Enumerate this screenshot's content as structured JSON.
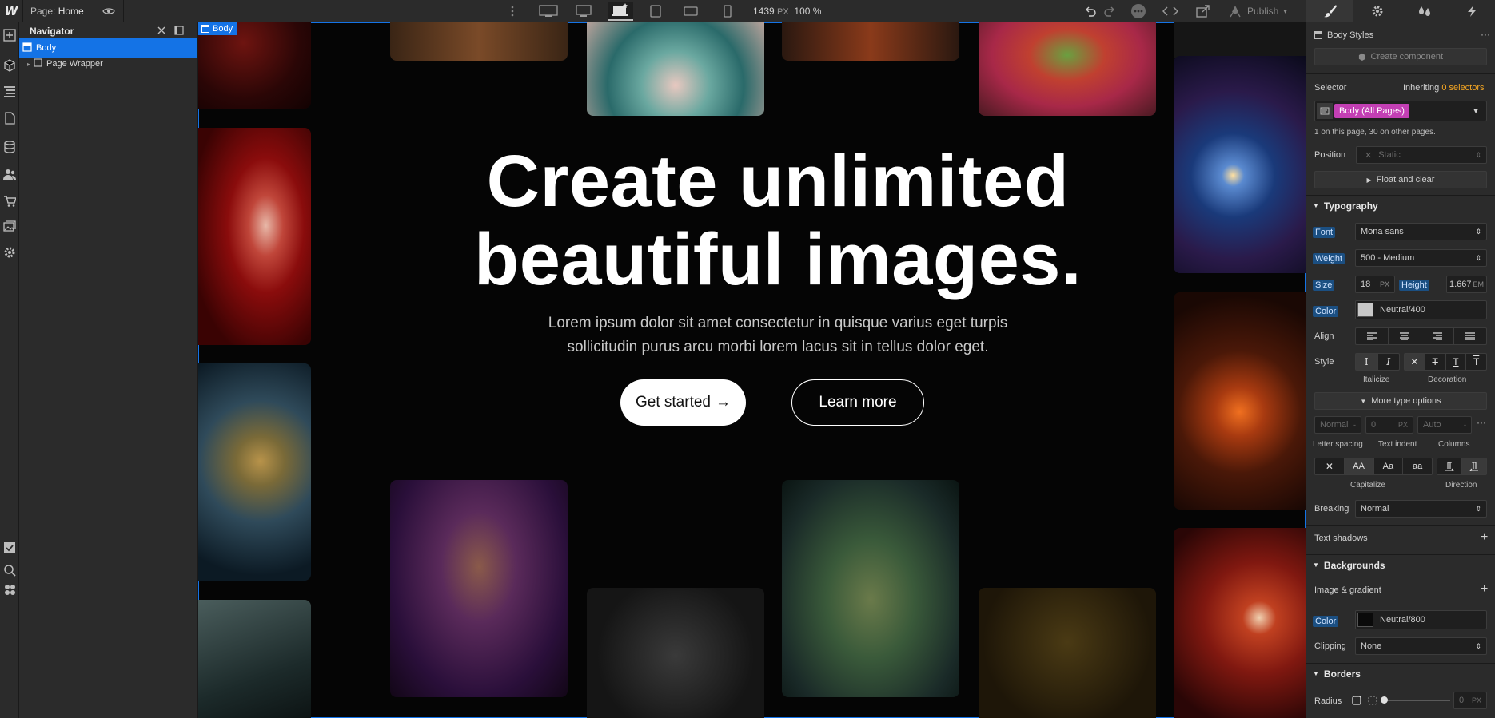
{
  "topbar": {
    "logo": "W",
    "page_prefix": "Page:",
    "page_name": "Home",
    "canvas_width": "1439",
    "canvas_width_unit": "PX",
    "zoom": "100 %",
    "publish_label": "Publish"
  },
  "navigator": {
    "title": "Navigator",
    "tree": [
      {
        "label": "Body",
        "selected": true
      },
      {
        "label": "Page Wrapper",
        "selected": false
      }
    ]
  },
  "canvas": {
    "selection_tag": "Body",
    "hero_title_line1": "Create unlimited",
    "hero_title_line2": "beautiful images.",
    "hero_subtitle_line1": "Lorem ipsum dolor sit amet consectetur in quisque varius eget turpis",
    "hero_subtitle_line2": "sollicitudin purus arcu morbi lorem lacus sit in tellus dolor eget.",
    "primary_button": "Get started",
    "primary_button_arrow": "→",
    "secondary_button": "Learn more"
  },
  "style_panel": {
    "element_styles_label": "Body Styles",
    "create_component_label": "Create component",
    "selector": {
      "label": "Selector",
      "inheriting_prefix": "Inheriting",
      "inheriting_count": "0 selectors",
      "chip": "Body (All Pages)",
      "usage_note": "1 on this page, 30 on other pages."
    },
    "position": {
      "label": "Position",
      "value": "Static"
    },
    "float_clear_label": "Float and clear",
    "typography": {
      "title": "Typography",
      "font_label": "Font",
      "font_value": "Mona sans",
      "weight_label": "Weight",
      "weight_value": "500 - Medium",
      "size_label": "Size",
      "size_value": "18",
      "size_unit": "PX",
      "height_label": "Height",
      "height_value": "1.667",
      "height_unit": "EM",
      "color_label": "Color",
      "color_value": "Neutral/400",
      "color_swatch": "#c8c8c8",
      "align_label": "Align",
      "style_label": "Style",
      "italicize_label": "Italicize",
      "decoration_label": "Decoration",
      "more_type_options": "More type options",
      "letter_spacing_placeholder": "Normal",
      "text_indent_value": "0",
      "text_indent_unit": "PX",
      "columns_placeholder": "Auto",
      "letter_spacing_label": "Letter spacing",
      "text_indent_label": "Text indent",
      "columns_label": "Columns",
      "capitalize_options": [
        "AA",
        "Aa",
        "aa"
      ],
      "capitalize_label": "Capitalize",
      "direction_label": "Direction",
      "breaking_label": "Breaking",
      "breaking_value": "Normal",
      "text_shadows_label": "Text shadows"
    },
    "backgrounds": {
      "title": "Backgrounds",
      "image_gradient_label": "Image & gradient",
      "color_label": "Color",
      "color_value": "Neutral/800",
      "color_swatch": "#0a0a0a",
      "clipping_label": "Clipping",
      "clipping_value": "None"
    },
    "borders": {
      "title": "Borders",
      "radius_label": "Radius",
      "radius_value": "0",
      "radius_unit": "PX"
    }
  },
  "colors": {
    "accent_blue": "#1473e6",
    "selector_chip": "#c33fb4",
    "inherit_orange": "#f5a623"
  }
}
